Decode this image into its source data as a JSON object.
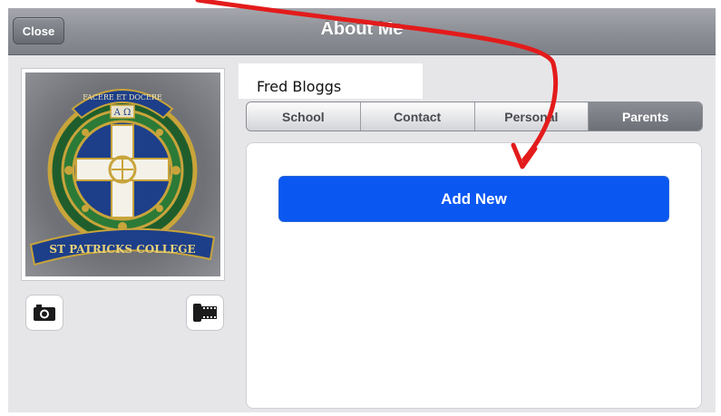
{
  "header": {
    "title": "About Me",
    "close_label": "Close"
  },
  "profile": {
    "name": "Fred Bloggs"
  },
  "logo": {
    "top_text": "FACERE ET DOCERE",
    "symbols": "A Ω",
    "banner_text": "ST PATRICKS COLLEGE"
  },
  "tabs": [
    {
      "label": "School",
      "active": false
    },
    {
      "label": "Contact",
      "active": false
    },
    {
      "label": "Personal",
      "active": false
    },
    {
      "label": "Parents",
      "active": true
    }
  ],
  "panel": {
    "add_label": "Add New"
  },
  "icons": {
    "camera": "camera-icon",
    "film": "film-roll-icon"
  },
  "colors": {
    "accent": "#0a57f2",
    "annotation_arrow": "#e31b1b"
  }
}
